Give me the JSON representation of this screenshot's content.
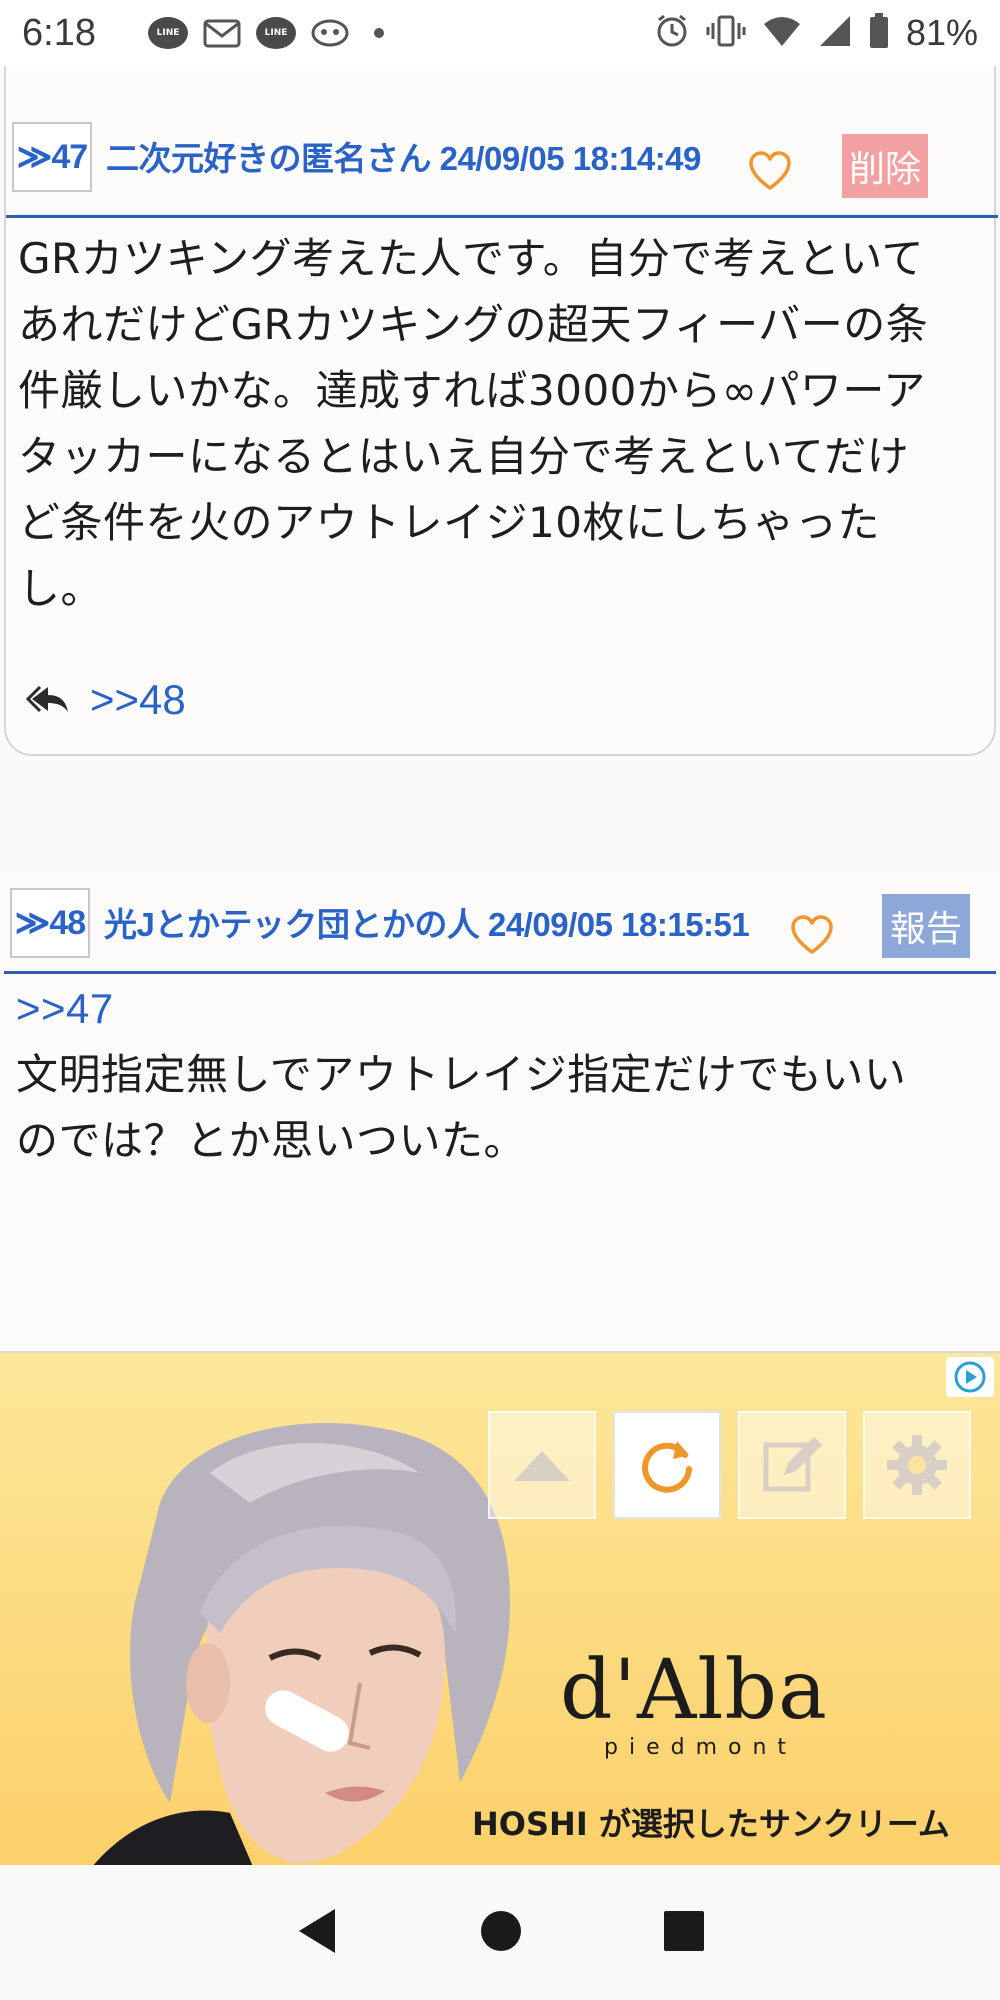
{
  "status_bar": {
    "time": "6:18",
    "line_label": "LINE",
    "battery": "81%",
    "icons": [
      "line-icon",
      "mail-icon",
      "line-icon",
      "tamagotchi-icon",
      "alarm-icon",
      "vibrate-icon",
      "wifi-icon",
      "signal-icon",
      "battery-icon"
    ]
  },
  "posts": [
    {
      "number": "≫47",
      "author": "二次元好きの匿名さん",
      "datetime": "24/09/05 18:14:49",
      "action_label": "削除",
      "body_lines": [
        "GRカツキング考えた人です。自分で考えといて",
        "あれだけどGRカツキングの超天フィーバーの条",
        "件厳しいかな。達成すれば3000から∞パワーア",
        "タッカーになるとはいえ自分で考えといてだけ",
        "ど条件を火のアウトレイジ10枚にしちゃった",
        "し。"
      ],
      "reply_link": ">>48"
    },
    {
      "number": "≫48",
      "author": "光Jとかテック団とかの人",
      "datetime": "24/09/05 18:15:51",
      "action_label": "報告",
      "anchor": ">>47",
      "body_lines": [
        "文明指定無しでアウトレイジ指定だけでもいい",
        "のでは？とか思いついた。"
      ]
    }
  ],
  "ad": {
    "brand": "d'Alba",
    "sub": "piedmont",
    "tagline": "HOSHI が選択したサンクリーム"
  },
  "toolbar": {
    "buttons": [
      "scroll-up-icon",
      "refresh-icon",
      "edit-icon",
      "settings-icon"
    ]
  },
  "colors": {
    "accent": "#2a63c8",
    "delete_bg": "#f3a0a0",
    "report_bg": "#8da7d8",
    "heart": "#f0962a",
    "refresh": "#f0962a"
  }
}
